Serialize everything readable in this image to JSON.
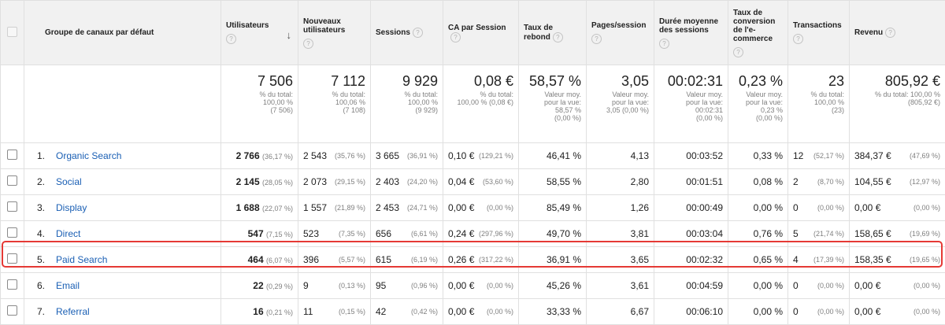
{
  "columns": {
    "channel": "Groupe de canaux par défaut",
    "users": "Utilisateurs",
    "new_users": "Nouveaux utilisateurs",
    "sessions": "Sessions",
    "rev_per_session": "CA par Session",
    "bounce_rate": "Taux de rebond",
    "pages_session": "Pages/session",
    "avg_duration": "Durée moyenne des sessions",
    "conv_rate": "Taux de conversion de l'e-commerce",
    "transactions": "Transactions",
    "revenue": "Revenu"
  },
  "help_glyph": "?",
  "sort_glyph": "↓",
  "totals": {
    "users": {
      "value": "7 506",
      "sub": "% du total:\n100,00 %\n(7 506)"
    },
    "new_users": {
      "value": "7 112",
      "sub": "% du total:\n100,06 %\n(7 108)"
    },
    "sessions": {
      "value": "9 929",
      "sub": "% du total:\n100,00 %\n(9 929)"
    },
    "rev_per_session": {
      "value": "0,08 €",
      "sub": "% du total:\n100,00 % (0,08 €)"
    },
    "bounce_rate": {
      "value": "58,57 %",
      "sub": "Valeur moy.\npour la vue:\n58,57 %\n(0,00 %)"
    },
    "pages_session": {
      "value": "3,05",
      "sub": "Valeur moy.\npour la vue:\n3,05 (0,00 %)"
    },
    "avg_duration": {
      "value": "00:02:31",
      "sub": "Valeur moy.\npour la vue:\n00:02:31\n(0,00 %)"
    },
    "conv_rate": {
      "value": "0,23 %",
      "sub": "Valeur moy.\npour la vue:\n0,23 %\n(0,00 %)"
    },
    "transactions": {
      "value": "23",
      "sub": "% du total:\n100,00 %\n(23)"
    },
    "revenue": {
      "value": "805,92 €",
      "sub": "% du total: 100,00 %\n(805,92 €)"
    }
  },
  "rows": [
    {
      "index": "1.",
      "channel": "Organic Search",
      "users": "2 766",
      "users_pct": "(36,17 %)",
      "new_users": "2 543",
      "new_users_pct": "(35,76 %)",
      "sessions": "3 665",
      "sessions_pct": "(36,91 %)",
      "rps": "0,10 €",
      "rps_pct": "(129,21 %)",
      "bounce": "46,41 %",
      "pages": "4,13",
      "duration": "00:03:52",
      "conv": "0,33 %",
      "trans": "12",
      "trans_pct": "(52,17 %)",
      "revenue": "384,37 €",
      "revenue_pct": "(47,69 %)"
    },
    {
      "index": "2.",
      "channel": "Social",
      "users": "2 145",
      "users_pct": "(28,05 %)",
      "new_users": "2 073",
      "new_users_pct": "(29,15 %)",
      "sessions": "2 403",
      "sessions_pct": "(24,20 %)",
      "rps": "0,04 €",
      "rps_pct": "(53,60 %)",
      "bounce": "58,55 %",
      "pages": "2,80",
      "duration": "00:01:51",
      "conv": "0,08 %",
      "trans": "2",
      "trans_pct": "(8,70 %)",
      "revenue": "104,55 €",
      "revenue_pct": "(12,97 %)"
    },
    {
      "index": "3.",
      "channel": "Display",
      "users": "1 688",
      "users_pct": "(22,07 %)",
      "new_users": "1 557",
      "new_users_pct": "(21,89 %)",
      "sessions": "2 453",
      "sessions_pct": "(24,71 %)",
      "rps": "0,00 €",
      "rps_pct": "(0,00 %)",
      "bounce": "85,49 %",
      "pages": "1,26",
      "duration": "00:00:49",
      "conv": "0,00 %",
      "trans": "0",
      "trans_pct": "(0,00 %)",
      "revenue": "0,00 €",
      "revenue_pct": "(0,00 %)"
    },
    {
      "index": "4.",
      "channel": "Direct",
      "users": "547",
      "users_pct": "(7,15 %)",
      "new_users": "523",
      "new_users_pct": "(7,35 %)",
      "sessions": "656",
      "sessions_pct": "(6,61 %)",
      "rps": "0,24 €",
      "rps_pct": "(297,96 %)",
      "bounce": "49,70 %",
      "pages": "3,81",
      "duration": "00:03:04",
      "conv": "0,76 %",
      "trans": "5",
      "trans_pct": "(21,74 %)",
      "revenue": "158,65 €",
      "revenue_pct": "(19,69 %)"
    },
    {
      "index": "5.",
      "channel": "Paid Search",
      "users": "464",
      "users_pct": "(6,07 %)",
      "new_users": "396",
      "new_users_pct": "(5,57 %)",
      "sessions": "615",
      "sessions_pct": "(6,19 %)",
      "rps": "0,26 €",
      "rps_pct": "(317,22 %)",
      "bounce": "36,91 %",
      "pages": "3,65",
      "duration": "00:02:32",
      "conv": "0,65 %",
      "trans": "4",
      "trans_pct": "(17,39 %)",
      "revenue": "158,35 €",
      "revenue_pct": "(19,65 %)"
    },
    {
      "index": "6.",
      "channel": "Email",
      "users": "22",
      "users_pct": "(0,29 %)",
      "new_users": "9",
      "new_users_pct": "(0,13 %)",
      "sessions": "95",
      "sessions_pct": "(0,96 %)",
      "rps": "0,00 €",
      "rps_pct": "(0,00 %)",
      "bounce": "45,26 %",
      "pages": "3,61",
      "duration": "00:04:59",
      "conv": "0,00 %",
      "trans": "0",
      "trans_pct": "(0,00 %)",
      "revenue": "0,00 €",
      "revenue_pct": "(0,00 %)"
    },
    {
      "index": "7.",
      "channel": "Referral",
      "users": "16",
      "users_pct": "(0,21 %)",
      "new_users": "11",
      "new_users_pct": "(0,15 %)",
      "sessions": "42",
      "sessions_pct": "(0,42 %)",
      "rps": "0,00 €",
      "rps_pct": "(0,00 %)",
      "bounce": "33,33 %",
      "pages": "6,67",
      "duration": "00:06:10",
      "conv": "0,00 %",
      "trans": "0",
      "trans_pct": "(0,00 %)",
      "revenue": "0,00 €",
      "revenue_pct": "(0,00 %)"
    }
  ],
  "colors": {
    "link": "#1a5fb4",
    "highlight": "#e53935",
    "header_bg": "#f1f1f1"
  }
}
